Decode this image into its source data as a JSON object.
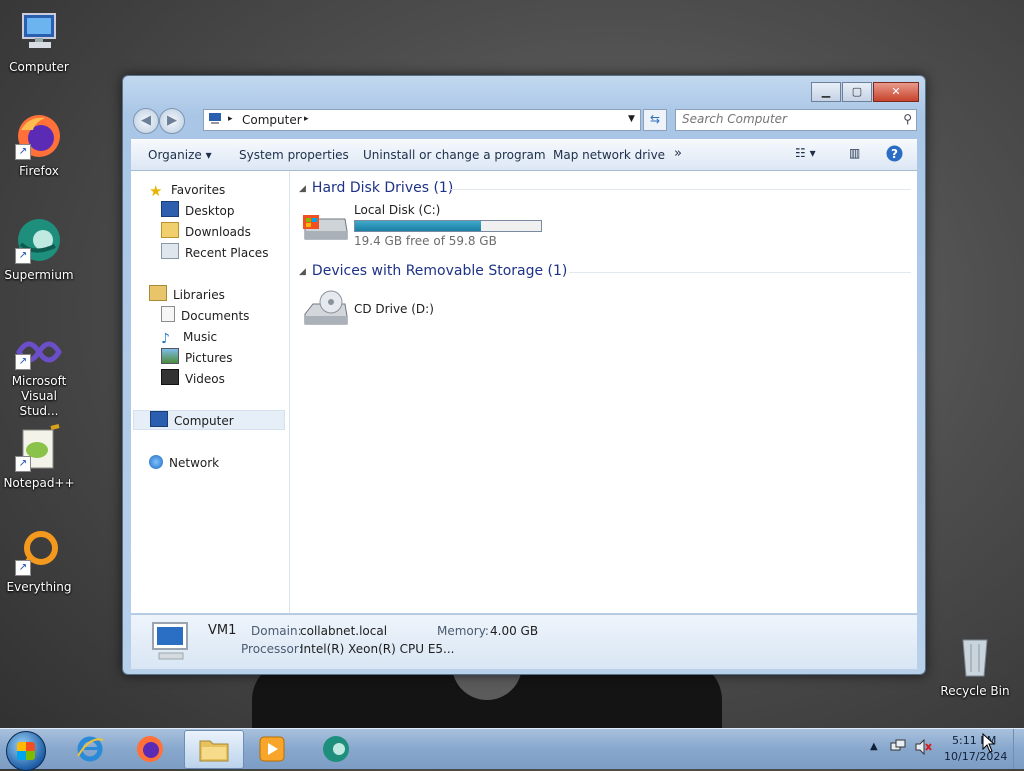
{
  "desktop": {
    "icons": [
      {
        "label": "Computer"
      },
      {
        "label": "Firefox"
      },
      {
        "label": "Supermium"
      },
      {
        "label": "Microsoft Visual Stud..."
      },
      {
        "label": "Notepad++"
      },
      {
        "label": "Everything"
      },
      {
        "label": "Recycle Bin"
      }
    ]
  },
  "window": {
    "controls": {
      "minimize": "▁",
      "maximize": "▢",
      "close": "✕"
    },
    "address": {
      "path_root": "Computer",
      "separator": "▸"
    },
    "search": {
      "placeholder": "Search Computer"
    },
    "toolbar": {
      "organize": "Organize ▾",
      "system_properties": "System properties",
      "uninstall": "Uninstall or change a program",
      "map_drive": "Map network drive",
      "more": "»"
    },
    "nav": {
      "favorites": "Favorites",
      "desktop": "Desktop",
      "downloads": "Downloads",
      "recent": "Recent Places",
      "libraries": "Libraries",
      "documents": "Documents",
      "music": "Music",
      "pictures": "Pictures",
      "videos": "Videos",
      "computer": "Computer",
      "network": "Network"
    },
    "groups": {
      "hdd": "Hard Disk Drives (1)",
      "removable": "Devices with Removable Storage (1)"
    },
    "drives": {
      "c": {
        "name": "Local Disk (C:)",
        "free": "19.4 GB free of 59.8 GB",
        "used_fraction": 0.676
      },
      "d": {
        "name": "CD Drive (D:)"
      }
    },
    "details": {
      "name": "VM1",
      "domain_label": "Domain:",
      "domain": "collabnet.local",
      "memory_label": "Memory:",
      "memory": "4.00 GB",
      "processor_label": "Processor:",
      "processor": "Intel(R) Xeon(R) CPU E5..."
    }
  },
  "taskbar": {
    "time": "5:11 PM",
    "date": "10/17/2024"
  },
  "colors": {
    "accent": "#1e3287",
    "bar_fill": "#1a7fa5"
  }
}
